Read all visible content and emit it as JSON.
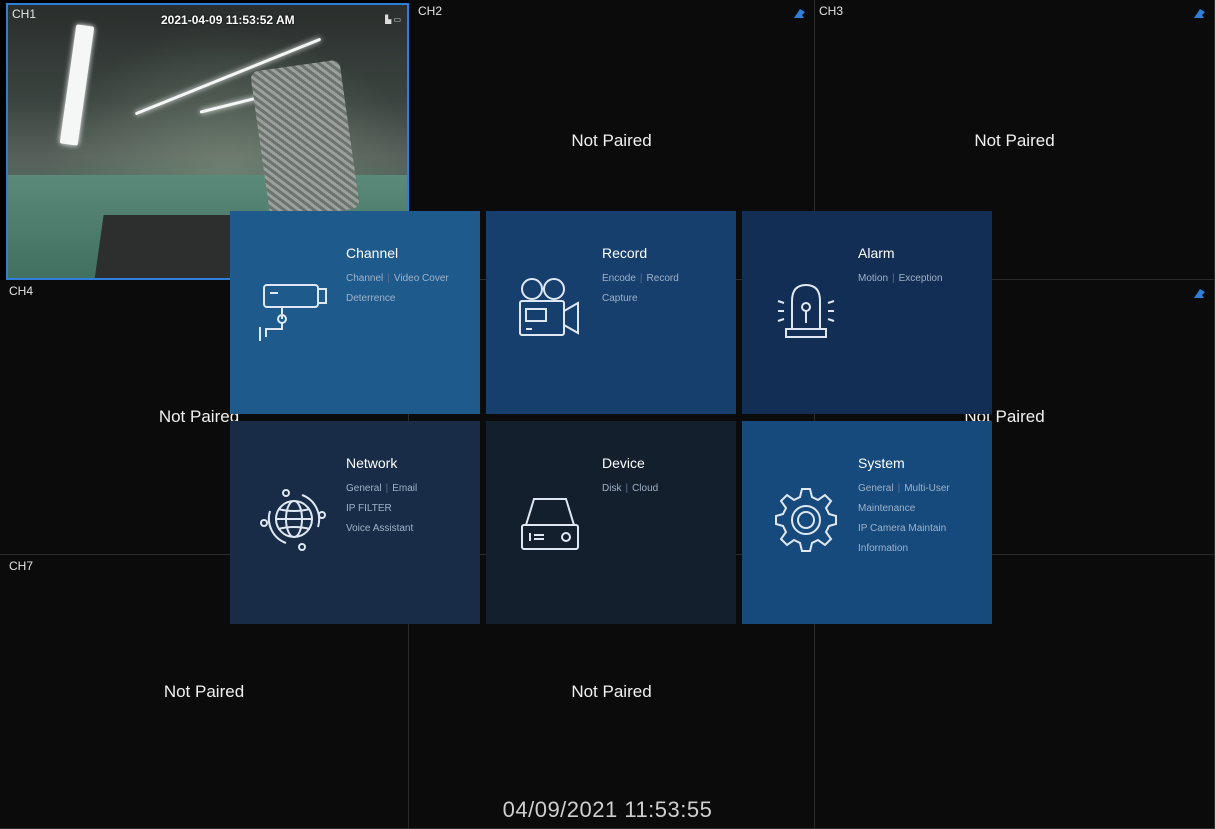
{
  "channels": [
    {
      "label": "CH1",
      "timestamp": "2021-04-09 11:53:52 AM",
      "status_icons": "▙ ▭"
    },
    {
      "label": "CH2",
      "status": "Not Paired"
    },
    {
      "label": "CH3",
      "status": "Not Paired"
    },
    {
      "label": "CH4",
      "status": "Not Paired"
    },
    {
      "label": "",
      "status": "Not Paired"
    },
    {
      "label": "",
      "status": ""
    },
    {
      "label": "CH7",
      "status": "Not Paired"
    },
    {
      "label": "",
      "status": "Not Paired"
    },
    {
      "label": "",
      "status": ""
    }
  ],
  "menu": [
    {
      "title": "Channel",
      "lines": [
        [
          "Channel",
          "Video Cover"
        ],
        [
          "Deterrence"
        ]
      ],
      "icon": "camera-icon",
      "color": "#1f5a8c"
    },
    {
      "title": "Record",
      "lines": [
        [
          "Encode",
          "Record"
        ],
        [
          "Capture"
        ]
      ],
      "icon": "film-camera-icon",
      "color": "#163f6e"
    },
    {
      "title": "Alarm",
      "lines": [
        [
          "Motion",
          "Exception"
        ]
      ],
      "icon": "siren-icon",
      "color": "#132e54"
    },
    {
      "title": "Network",
      "lines": [
        [
          "General",
          "Email"
        ],
        [
          "IP FILTER"
        ],
        [
          "Voice Assistant"
        ]
      ],
      "icon": "globe-icon",
      "color": "#182c48"
    },
    {
      "title": "Device",
      "lines": [
        [
          "Disk",
          "Cloud"
        ]
      ],
      "icon": "hard-drive-icon",
      "color": "#141f2e"
    },
    {
      "title": "System",
      "lines": [
        [
          "General",
          "Multi-User"
        ],
        [
          "Maintenance"
        ],
        [
          "IP Camera Maintain"
        ],
        [
          "Information"
        ]
      ],
      "icon": "gear-icon",
      "color": "#164a7c"
    }
  ],
  "footer": {
    "datetime": "04/09/2021 11:53:55"
  },
  "colors": {
    "accent": "#2f7fd8",
    "background": "#000000"
  }
}
